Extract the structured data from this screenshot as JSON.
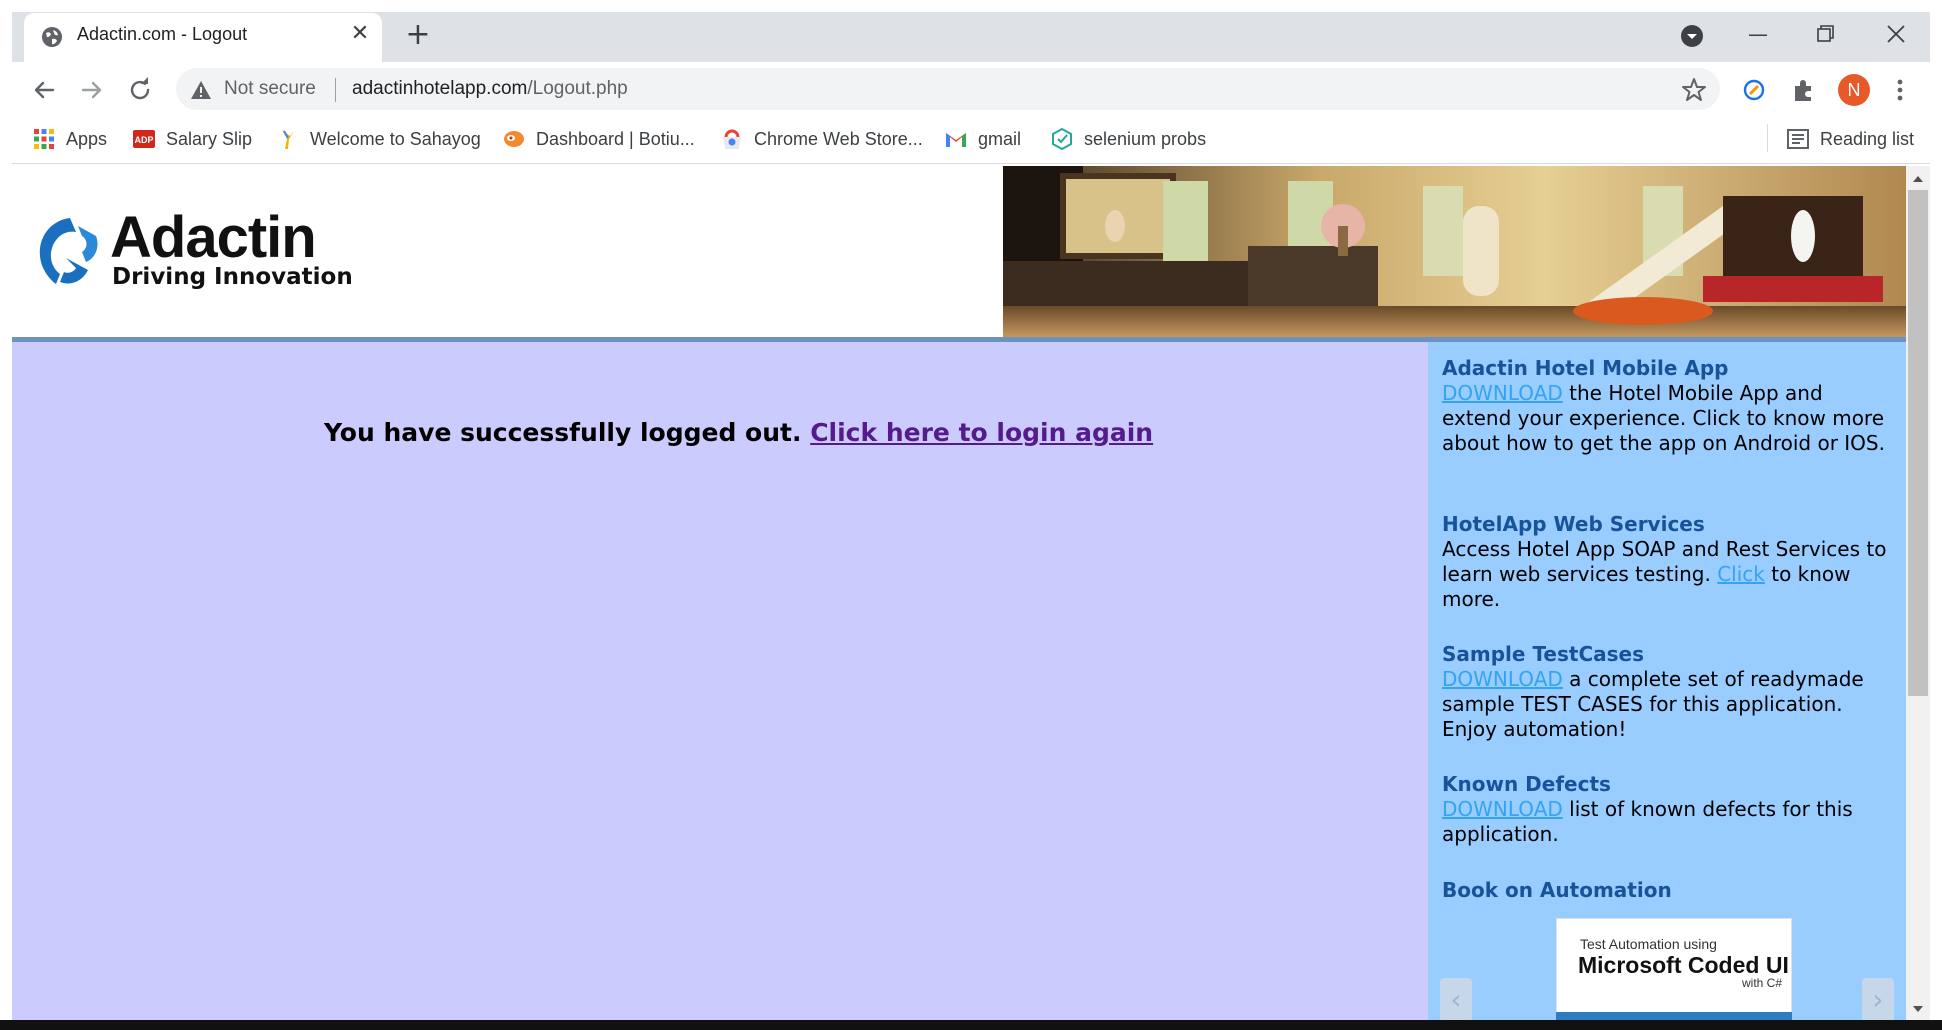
{
  "browser": {
    "tab_title": "Adactin.com - Logout",
    "security_label": "Not secure",
    "url_domain": "adactinhotelapp.com",
    "url_path": "/Logout.php",
    "profile_initial": "N",
    "bookmarks": [
      {
        "label": "Apps",
        "icon": "apps-grid-icon"
      },
      {
        "label": "Salary Slip",
        "icon": "adp-icon"
      },
      {
        "label": "Welcome to Sahayog",
        "icon": "sahayog-icon"
      },
      {
        "label": "Dashboard | Botiu...",
        "icon": "botium-icon"
      },
      {
        "label": "Chrome Web Store...",
        "icon": "chrome-web-store-icon"
      },
      {
        "label": "gmail",
        "icon": "gmail-icon"
      },
      {
        "label": "selenium probs",
        "icon": "selenium-icon"
      }
    ],
    "reading_list_label": "Reading list"
  },
  "header": {
    "logo_name": "Adactin",
    "logo_tagline": "Driving Innovation"
  },
  "main": {
    "logout_message": "You have successfully logged out.",
    "login_again_link": "Click here to login again"
  },
  "sidebar": {
    "mobile_app": {
      "title": "Adactin Hotel Mobile App",
      "link": "DOWNLOAD",
      "text": " the Hotel Mobile App and extend your experience. Click to know more about how to get the app on Android or IOS."
    },
    "web_services": {
      "title": "HotelApp Web Services",
      "text_before": "Access Hotel App SOAP and Rest Services to learn web services testing. ",
      "link": "Click",
      "text_after": " to know more."
    },
    "test_cases": {
      "title": "Sample TestCases",
      "link": "DOWNLOAD",
      "text": " a complete set of readymade sample TEST CASES for this application. Enjoy automation!"
    },
    "known_defects": {
      "title": "Known Defects",
      "link": "DOWNLOAD",
      "text": " list of known defects for this application."
    },
    "book": {
      "title": "Book on Automation",
      "cover_line1": "Test Automation using",
      "cover_line2": "Microsoft Coded UI",
      "cover_line3": "with C#"
    }
  },
  "colors": {
    "main_background": "#cbcbfd",
    "sidebar_background": "#99ccff",
    "sidebar_title": "#18539a",
    "sidebar_link": "#33a4f3",
    "visited_link": "#551a8b",
    "header_rule": "#6b93c2"
  }
}
